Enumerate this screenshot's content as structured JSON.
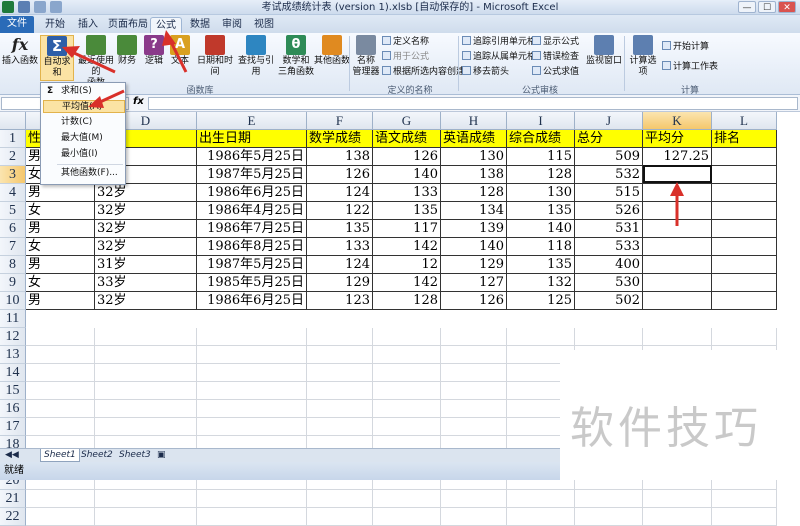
{
  "window": {
    "title": "考试成绩统计表 (version 1).xlsb [自动保存的] - Microsoft Excel",
    "min": "—",
    "max": "☐",
    "close": "✕"
  },
  "tabs": [
    "文件",
    "开始",
    "插入",
    "页面布局",
    "公式",
    "数据",
    "审阅",
    "视图"
  ],
  "ribbon": {
    "insert_function": "插入函数",
    "autosum": "自动求和",
    "recent": "最近使用的",
    "recent2": "函数",
    "financial": "财务",
    "logical": "逻辑",
    "text": "文本",
    "datetime": "日期和时间",
    "lookup": "查找与引用",
    "math": "数学和",
    "math2": "三角函数",
    "other": "其他函数",
    "name_manager": "名称",
    "name_manager2": "管理器",
    "define_name": "定义名称",
    "use_in_formula": "用于公式",
    "create_from_sel": "根据所选内容创建",
    "trace_precedents": "追踪引用单元格",
    "trace_dependents": "追踪从属单元格",
    "remove_arrows": "移去箭头",
    "show_formulas": "显示公式",
    "error_check": "错误检查",
    "eval_formula": "公式求值",
    "watch_window": "监视窗口",
    "calc_options": "计算选项",
    "calc_now": "开始计算",
    "calc_sheet": "计算工作表",
    "group_library": "函数库",
    "group_names": "定义的名称",
    "group_audit": "公式审核",
    "group_calc": "计算"
  },
  "formula_bar": {
    "fx": "fx",
    "name_box": "",
    "formula": ""
  },
  "dropdown": [
    "求和(S)",
    "平均值(A)",
    "计数(C)",
    "最大值(M)",
    "最小值(I)",
    "其他函数(F)..."
  ],
  "columns": [
    "D",
    "E",
    "F",
    "G",
    "H",
    "I",
    "J",
    "K",
    "L"
  ],
  "rows": [
    "1",
    "2",
    "3",
    "4",
    "5",
    "6",
    "7",
    "8",
    "9",
    "10",
    "11",
    "12",
    "13",
    "14",
    "15",
    "16",
    "17",
    "18",
    "19",
    "20",
    "21",
    "22"
  ],
  "header": {
    "c": "性",
    "e": "出生日期",
    "f": "数学成绩",
    "g": "语文成绩",
    "h": "英语成绩",
    "i": "综合成绩",
    "j": "总分",
    "k": "平均分",
    "l": "排名"
  },
  "data": [
    {
      "c": "男",
      "d": "",
      "e": "1986年5月25日",
      "f": "138",
      "g": "126",
      "h": "130",
      "i": "115",
      "j": "509",
      "k": "127.25"
    },
    {
      "c": "女",
      "d": "",
      "e": "1987年5月25日",
      "f": "126",
      "g": "140",
      "h": "138",
      "i": "128",
      "j": "532",
      "k": ""
    },
    {
      "c": "男",
      "d": "32岁",
      "e": "1986年6月25日",
      "f": "124",
      "g": "133",
      "h": "128",
      "i": "130",
      "j": "515",
      "k": ""
    },
    {
      "c": "女",
      "d": "32岁",
      "e": "1986年4月25日",
      "f": "122",
      "g": "135",
      "h": "134",
      "i": "135",
      "j": "526",
      "k": ""
    },
    {
      "c": "男",
      "d": "32岁",
      "e": "1986年7月25日",
      "f": "135",
      "g": "117",
      "h": "139",
      "i": "140",
      "j": "531",
      "k": ""
    },
    {
      "c": "女",
      "d": "32岁",
      "e": "1986年8月25日",
      "f": "133",
      "g": "142",
      "h": "140",
      "i": "118",
      "j": "533",
      "k": ""
    },
    {
      "c": "男",
      "d": "31岁",
      "e": "1987年5月25日",
      "f": "124",
      "g": "12",
      "h": "129",
      "i": "135",
      "j": "400",
      "k": ""
    },
    {
      "c": "女",
      "d": "33岁",
      "e": "1985年5月25日",
      "f": "129",
      "g": "142",
      "h": "127",
      "i": "132",
      "j": "530",
      "k": ""
    },
    {
      "c": "男",
      "d": "32岁",
      "e": "1986年6月25日",
      "f": "123",
      "g": "128",
      "h": "126",
      "i": "125",
      "j": "502",
      "k": ""
    }
  ],
  "sheets": [
    "Sheet1",
    "Sheet2",
    "Sheet3"
  ],
  "status": "就绪",
  "watermark": "软件技巧"
}
